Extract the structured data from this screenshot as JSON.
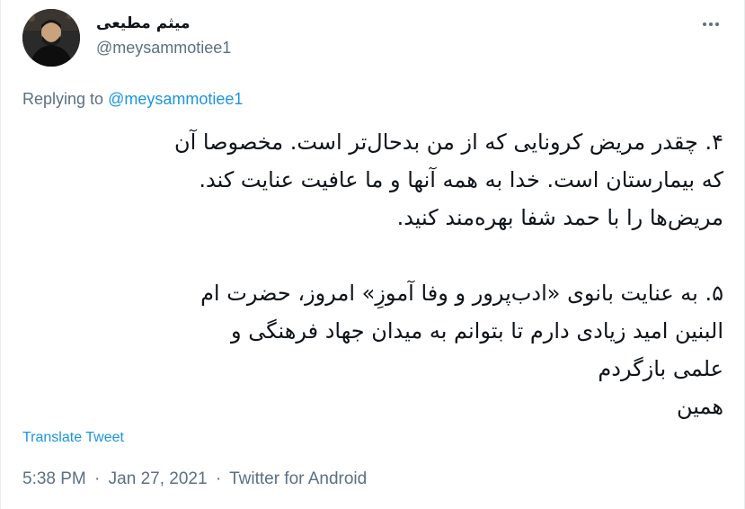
{
  "tweet": {
    "author_name": "میثم مطیعی",
    "author_handle": "@meysammotiee1",
    "replying_prefix": "Replying to",
    "replying_handle": "@meysammotiee1",
    "lines": [
      "۴. چقدر مریض کرونایی که از من بدحال‌تر است. مخصوصا آن",
      "که بیمارستان است. خدا به همه آنها و ما عافیت عنایت کند.",
      "مریض‌ها را با حمد شفا بهره‌مند کنید.",
      "",
      "۵. به عنایت بانوی «ادب‌پرور و وفا آموزِ» امروز، حضرت ام",
      "البنین امید زیادی دارم تا بتوانم به میدان جهاد فرهنگی و",
      "علمی بازگردم",
      "همین"
    ],
    "translate_label": "Translate Tweet",
    "time": "5:38 PM",
    "date": "Jan 27, 2021",
    "source": "Twitter for Android",
    "separator": "·"
  },
  "icons": {
    "more": "more-horizontal-icon",
    "avatar": "profile-photo"
  },
  "colors": {
    "link": "#1b95e0",
    "secondary_text": "#5b7083",
    "primary_text": "#0f1419"
  }
}
